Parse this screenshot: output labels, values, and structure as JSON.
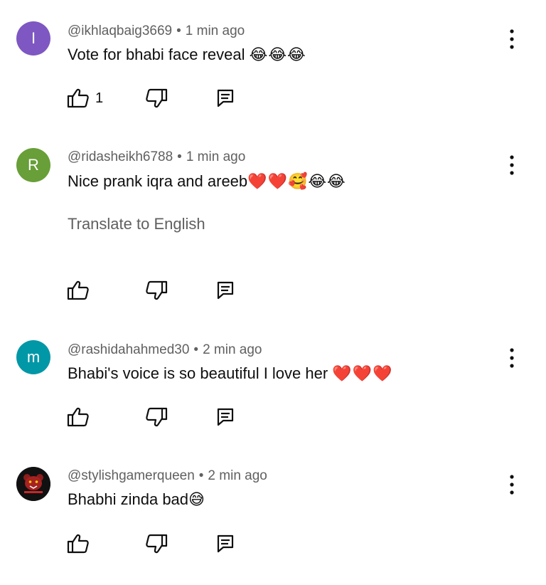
{
  "comments": [
    {
      "avatar_letter": "I",
      "avatar_color": "#7e57c2",
      "handle": "@ikhlaqbaig3669",
      "time": "1 min ago",
      "text": "Vote for bhabi face reveal ",
      "emoji": "😂😂😂",
      "like_count": "1"
    },
    {
      "avatar_letter": "R",
      "avatar_color": "#689f38",
      "handle": "@ridasheikh6788",
      "time": "1 min ago",
      "text": "Nice prank iqra and areeb",
      "emoji": "❤️❤️🥰😂😂",
      "translate_label": "Translate to English",
      "like_count": ""
    },
    {
      "avatar_letter": "m",
      "avatar_color": "#0097a7",
      "handle": "@rashidahahmed30",
      "time": "2 min ago",
      "text": "Bhabi's voice is so beautiful I love her ",
      "emoji": "❤️❤️❤️",
      "like_count": ""
    },
    {
      "avatar_letter": "",
      "avatar_color": "#111111",
      "handle": "@stylishgamerqueen",
      "time": "2 min ago",
      "text": "Bhabhi zinda bad",
      "emoji": "😅",
      "like_count": ""
    }
  ],
  "separator": "•",
  "icons": {
    "like": "thumb-up-icon",
    "dislike": "thumb-down-icon",
    "reply": "reply-comment-icon",
    "more": "more-vertical-icon"
  }
}
